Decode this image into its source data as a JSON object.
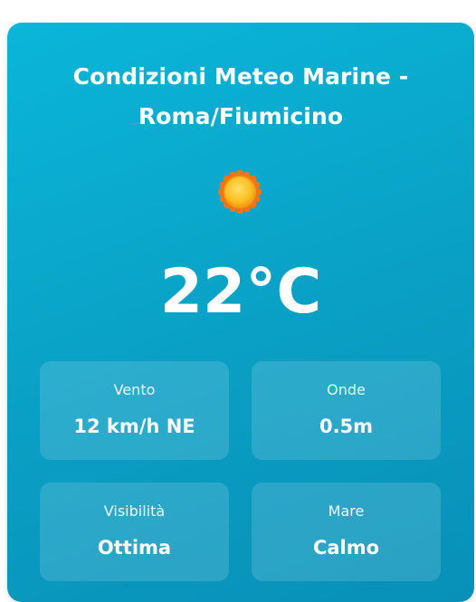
{
  "card": {
    "title_line1": "Condizioni Meteo Marine -",
    "title_line2": "Roma/Fiumicino",
    "icon": "sun-icon",
    "temperature": "22°C"
  },
  "metrics": [
    {
      "label": "Vento",
      "value": "12 km/h NE"
    },
    {
      "label": "Onde",
      "value": "0.5m"
    },
    {
      "label": "Visibilità",
      "value": "Ottima"
    },
    {
      "label": "Mare",
      "value": "Calmo"
    }
  ],
  "colors": {
    "card_gradient_start": "#0ab6d9",
    "card_gradient_end": "#0890b8",
    "sun_fill": "#fbbf24",
    "sun_rays": "#f97316"
  }
}
